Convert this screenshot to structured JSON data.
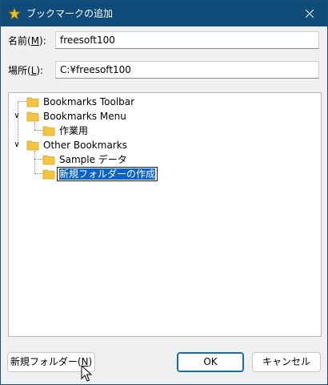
{
  "window": {
    "title": "ブックマークの追加",
    "star_icon_color": "#e8c228",
    "titlebar_color": "#0f4c7a"
  },
  "name_field": {
    "label_prefix": "名前(",
    "label_key": "M",
    "label_suffix": "):",
    "value": "freesoft100"
  },
  "location_field": {
    "label_prefix": "場所(",
    "label_key": "L",
    "label_suffix": "):",
    "value": "C:¥freesoft100"
  },
  "tree": {
    "items": [
      {
        "label": "Bookmarks Toolbar"
      },
      {
        "label": "Bookmarks Menu",
        "expanded": true
      },
      {
        "label": "作業用"
      },
      {
        "label": "Other Bookmarks",
        "expanded": true
      },
      {
        "label": "Sample データ"
      },
      {
        "label": "新規フォルダーの作成",
        "editing": true
      }
    ],
    "folder_color": "#f5c542"
  },
  "buttons": {
    "new_folder_prefix": "新規フォルダー(",
    "new_folder_key": "N",
    "new_folder_suffix": ")",
    "ok": "OK",
    "cancel": "キャンセル"
  }
}
